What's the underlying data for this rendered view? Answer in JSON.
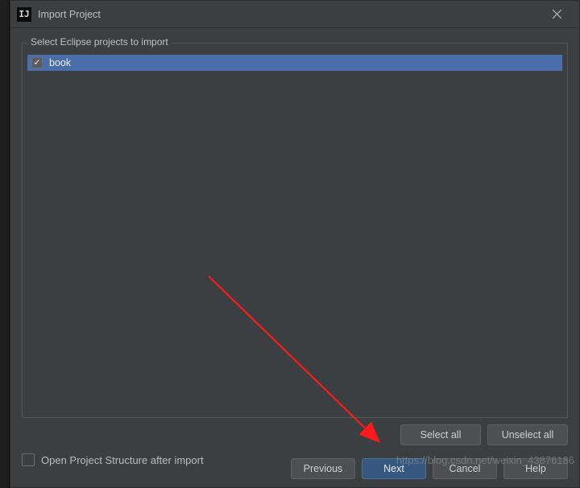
{
  "dialog": {
    "title": "Import Project",
    "app_icon_text": "IJ"
  },
  "fieldset": {
    "legend": "Select Eclipse projects to import"
  },
  "projects": [
    {
      "name": "book",
      "checked": true
    }
  ],
  "buttons": {
    "select_all": "Select all",
    "unselect_all": "Unselect all",
    "previous": "Previous",
    "next": "Next",
    "cancel": "Cancel",
    "help": "Help"
  },
  "options": {
    "open_structure_label": "Open Project Structure after import",
    "open_structure_checked": false
  },
  "watermark": "https://blog.csdn.net/weixin_43876186"
}
